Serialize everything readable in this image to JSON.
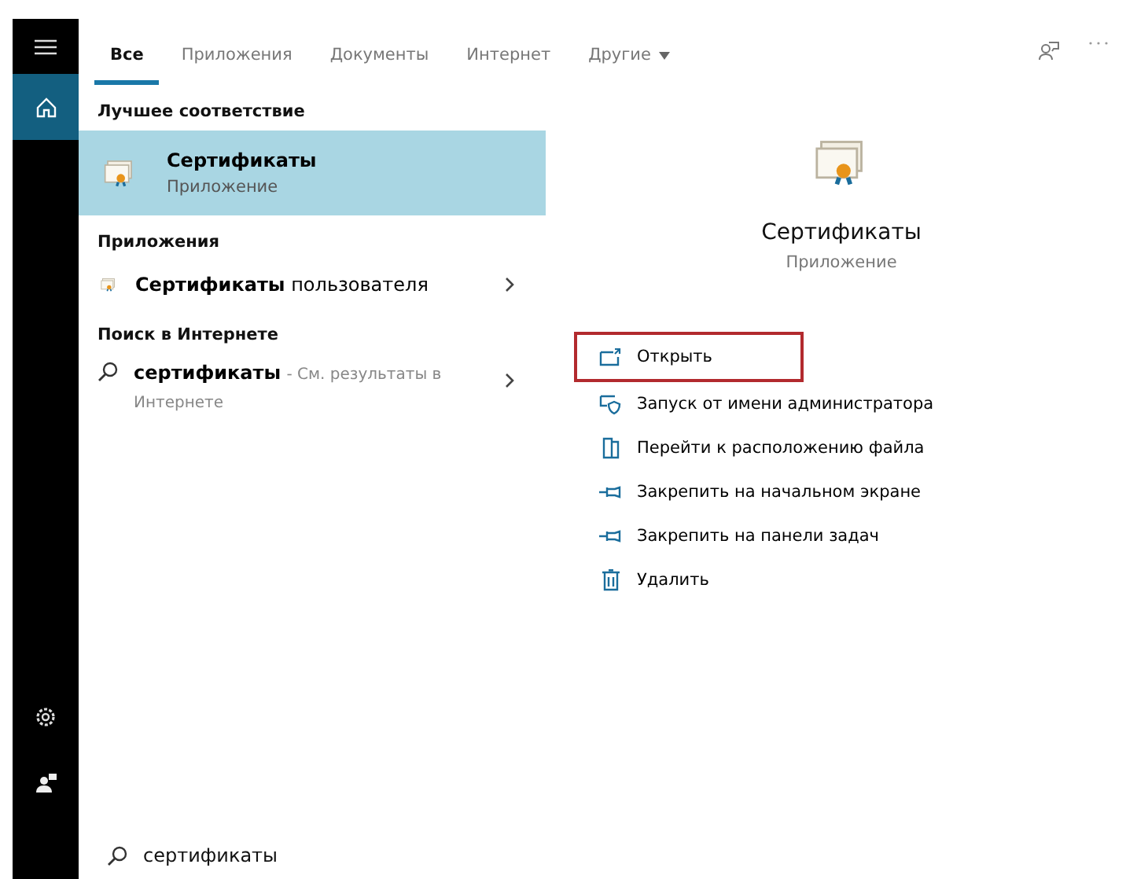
{
  "sidebar": {
    "items": [
      {
        "kind": "menu",
        "selected": false
      },
      {
        "kind": "home",
        "selected": true
      },
      {
        "kind": "settings",
        "selected": false
      },
      {
        "kind": "user",
        "selected": false
      }
    ]
  },
  "tabs": [
    {
      "label": "Все",
      "selected": true,
      "kind": "tab"
    },
    {
      "label": "Приложения",
      "selected": false,
      "kind": "tab"
    },
    {
      "label": "Документы",
      "selected": false,
      "kind": "tab"
    },
    {
      "label": "Интернет",
      "selected": false,
      "kind": "tab"
    },
    {
      "label": "Другие",
      "selected": false,
      "kind": "dropdown"
    }
  ],
  "results": [
    {
      "heading": "Лучшее соответствие",
      "items": [
        {
          "kind": "best",
          "title": "Сертификаты",
          "subtitle": "Приложение",
          "selected": true
        }
      ]
    },
    {
      "heading": "Приложения",
      "items": [
        {
          "kind": "app",
          "title": "Сертификаты",
          "title_rest": "пользователя",
          "selected": false
        }
      ]
    },
    {
      "heading": "Поиск в Интернете",
      "items": [
        {
          "kind": "web",
          "title": "сертификаты",
          "hint": "- См. результаты в Интернете",
          "selected": false
        }
      ]
    }
  ],
  "detail": {
    "title": "Сертификаты",
    "subtitle": "Приложение",
    "actions": [
      {
        "kind": "open",
        "label": "Открыть",
        "highlighted": true
      },
      {
        "kind": "admin",
        "label": "Запуск от имени администратора",
        "highlighted": false
      },
      {
        "kind": "folder",
        "label": "Перейти к расположению файла",
        "highlighted": false
      },
      {
        "kind": "pin",
        "label": "Закрепить на начальном экране",
        "highlighted": false
      },
      {
        "kind": "pin",
        "label": "Закрепить на панели задач",
        "highlighted": false
      },
      {
        "kind": "delete",
        "label": "Удалить",
        "highlighted": false
      }
    ]
  },
  "search": {
    "value": "сертификаты"
  }
}
